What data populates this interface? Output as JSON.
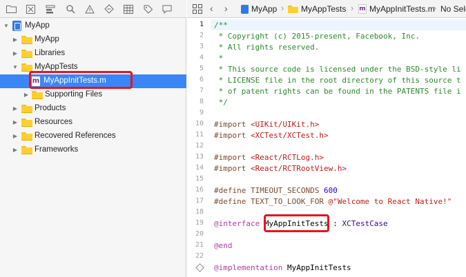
{
  "navigator": {
    "toolbar_icons": [
      "folder-icon",
      "close-square-icon",
      "hierarchy-icon",
      "search-icon",
      "warning-icon",
      "diamond-icon",
      "grid-icon",
      "tag-icon",
      "speech-bubble-icon"
    ],
    "items": [
      {
        "label": "MyApp",
        "type": "project",
        "expanded": true
      },
      {
        "label": "MyApp",
        "type": "folder",
        "expanded": false
      },
      {
        "label": "Libraries",
        "type": "folder",
        "expanded": false
      },
      {
        "label": "MyAppTests",
        "type": "folder",
        "expanded": true
      },
      {
        "label": "MyAppInitTests.m",
        "type": "m-file",
        "selected": true
      },
      {
        "label": "Supporting Files",
        "type": "folder",
        "expanded": false
      },
      {
        "label": "Products",
        "type": "folder",
        "expanded": false
      },
      {
        "label": "Resources",
        "type": "folder",
        "expanded": false
      },
      {
        "label": "Recovered References",
        "type": "folder",
        "expanded": false
      },
      {
        "label": "Frameworks",
        "type": "folder",
        "expanded": false
      }
    ]
  },
  "editor": {
    "jumpbar": {
      "items": [
        "MyApp",
        "MyAppTests",
        "MyAppInitTests.m",
        "No Sele"
      ]
    },
    "lines": [
      {
        "n": "1",
        "text": "/**"
      },
      {
        "n": "2",
        "text": " * Copyright (c) 2015-present, Facebook, Inc."
      },
      {
        "n": "3",
        "text": " * All rights reserved."
      },
      {
        "n": "4",
        "text": " *"
      },
      {
        "n": "5",
        "text": " * This source code is licensed under the BSD-style li"
      },
      {
        "n": "6",
        "text": " * LICENSE file in the root directory of this source t"
      },
      {
        "n": "7",
        "text": " * of patent rights can be found in the PATENTS file i"
      },
      {
        "n": "8",
        "text": " */"
      },
      {
        "n": "9",
        "text": ""
      },
      {
        "n": "10",
        "text": "#import <UIKit/UIKit.h>"
      },
      {
        "n": "11",
        "text": "#import <XCTest/XCTest.h>"
      },
      {
        "n": "12",
        "text": ""
      },
      {
        "n": "13",
        "text": "#import <React/RCTLog.h>"
      },
      {
        "n": "14",
        "text": "#import <React/RCTRootView.h>"
      },
      {
        "n": "15",
        "text": ""
      },
      {
        "n": "16",
        "text": "#define TIMEOUT_SECONDS 600"
      },
      {
        "n": "17",
        "text": "#define TEXT_TO_LOOK_FOR @\"Welcome to React Native!\""
      },
      {
        "n": "18",
        "text": ""
      },
      {
        "n": "19",
        "text": "@interface MyAppInitTests : XCTestCase"
      },
      {
        "n": "20",
        "text": ""
      },
      {
        "n": "21",
        "text": "@end"
      },
      {
        "n": "22",
        "text": ""
      },
      {
        "n": "",
        "text": "@implementation MyAppInitTests"
      }
    ],
    "tokens": {
      "import_kw": "#import",
      "define_kw": "#define",
      "uikit_path": "<UIKit/UIKit.h>",
      "xctest_path": "<XCTest/XCTest.h>",
      "rctlog_path": "<React/RCTLog.h>",
      "rctroot_path": "<React/RCTRootView.h>",
      "timeout_name": "TIMEOUT_SECONDS",
      "timeout_value": "600",
      "text_name": "TEXT_TO_LOOK_FOR",
      "text_value": "@\"Welcome to React Native!\"",
      "interface_kw": "@interface",
      "class_name": "MyAppInitTests",
      "colon": ":",
      "superclass": "XCTestCase",
      "end_kw": "@end",
      "implementation_kw": "@implementation",
      "impl_class": "MyAppInitTests"
    }
  },
  "colors": {
    "selection": "#3b86f7",
    "highlight_box": "#e8141a",
    "comment": "#2a8a2a",
    "string": "#c41a16",
    "keyword": "#ad3da4"
  }
}
